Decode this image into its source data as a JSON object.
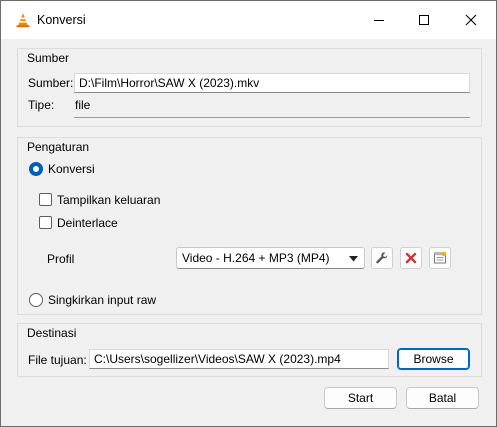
{
  "window": {
    "title": "Konversi",
    "app_icon": "vlc-cone-icon",
    "controls": [
      "minimize-icon",
      "maximize-icon",
      "close-icon"
    ]
  },
  "source": {
    "group_title": "Sumber",
    "source_label": "Sumber:",
    "source_value": "D:\\Film\\Horror\\SAW X (2023).mkv",
    "type_label": "Tipe:",
    "type_value": "file"
  },
  "settings": {
    "group_title": "Pengaturan",
    "convert_label": "Konversi",
    "convert_selected": true,
    "show_output_label": "Tampilkan keluaran",
    "show_output_checked": false,
    "deinterlace_label": "Deinterlace",
    "deinterlace_checked": false,
    "profile_label": "Profil",
    "profile_value": "Video - H.264 + MP3 (MP4)",
    "profile_tools": [
      "wrench-icon",
      "delete-icon",
      "new-profile-icon"
    ],
    "raw_label": "Singkirkan input raw",
    "raw_selected": false
  },
  "destination": {
    "group_title": "Destinasi",
    "file_label": "File tujuan:",
    "file_value": "C:\\Users\\sogellizer\\Videos\\SAW X (2023).mp4",
    "browse_label": "Browse"
  },
  "footer": {
    "start_label": "Start",
    "cancel_label": "Batal"
  },
  "colors": {
    "accent": "#005fb8",
    "delete_red": "#d13438",
    "vlc_orange": "#f28c00"
  }
}
